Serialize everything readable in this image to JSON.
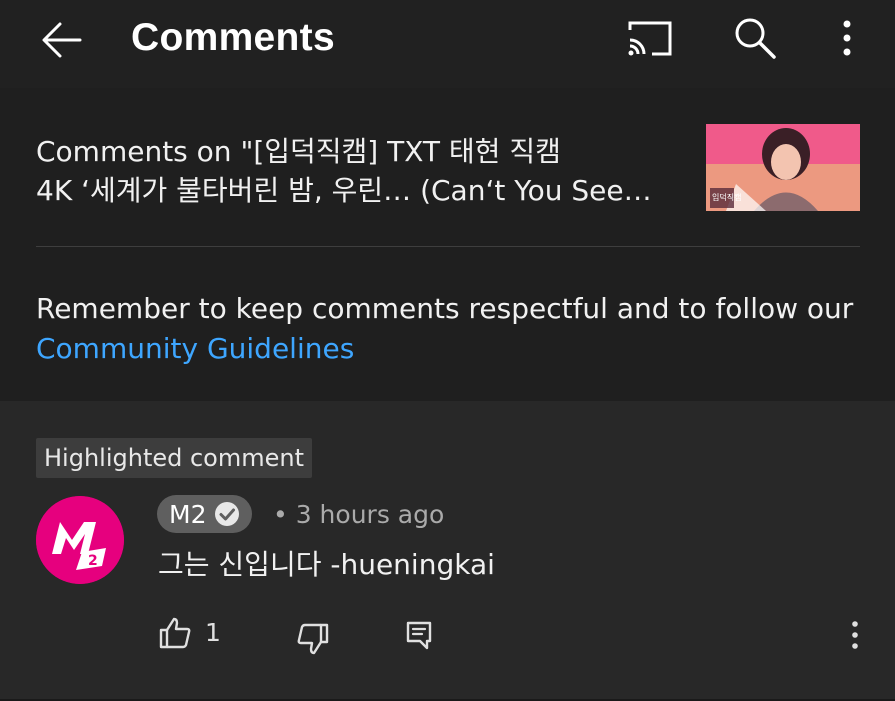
{
  "header": {
    "title": "Comments",
    "icons": [
      "back-arrow-icon",
      "cast-icon",
      "search-icon",
      "more-vert-icon"
    ]
  },
  "video": {
    "title_line1": "Comments on \"[입덕직캠] TXT 태현 직캠",
    "title_line2": "4K ‘세계가 불타버린 밤, 우린… (Can‘t You See…",
    "thumbnail_label": "입덕직캠"
  },
  "notice": {
    "text": "Remember to keep comments respectful and to follow our ",
    "link": "Community Guidelines"
  },
  "comment": {
    "badge": "Highlighted comment",
    "author": "M2",
    "separator": "•",
    "time": "3 hours ago",
    "text": "그는 신입니다 -hueningkai",
    "likes": "1",
    "avatar_color": "#e6007e"
  },
  "colors": {
    "background": "#282828",
    "header_bg": "#212121",
    "link": "#3ea6ff",
    "secondary_text": "#aaaaaa"
  }
}
